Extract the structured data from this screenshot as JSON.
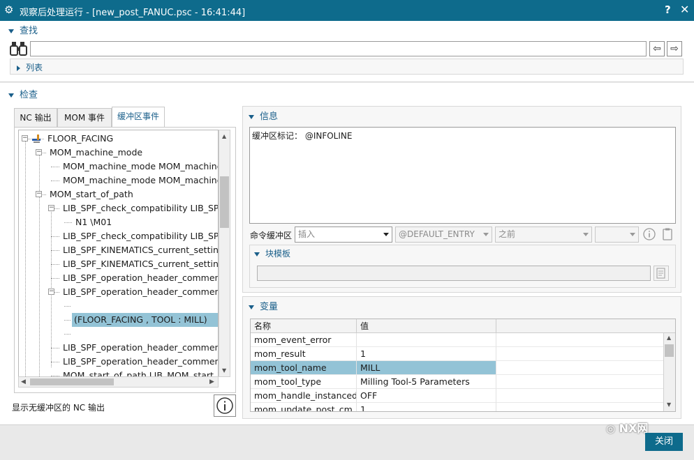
{
  "window": {
    "title": "观察后处理运行 - [new_post_FANUC.psc - 16:41:44]",
    "help_label": "?",
    "close_label": "✕"
  },
  "find": {
    "header": "查找",
    "search_value": "",
    "list_label": "列表"
  },
  "inspect": {
    "header": "检查",
    "tabs": [
      "NC 输出",
      "MOM 事件",
      "缓冲区事件"
    ],
    "active_tab": 2,
    "tree": [
      {
        "label": "FLOOR_FACING",
        "level": 0
      },
      {
        "label": "MOM_machine_mode",
        "level": 1
      },
      {
        "label": "MOM_machine_mode MOM_machine_mode",
        "level": 2
      },
      {
        "label": "MOM_machine_mode MOM_machine_mode",
        "level": 2
      },
      {
        "label": "MOM_start_of_path",
        "level": 1
      },
      {
        "label": "LIB_SPF_check_compatibility LIB_SPF_check_compatibility",
        "level": 2
      },
      {
        "label": "N1 \\M01",
        "level": 3
      },
      {
        "label": "LIB_SPF_check_compatibility LIB_SPF_check_compatibility",
        "level": 2
      },
      {
        "label": "LIB_SPF_KINEMATICS_current_setting LIB_SPF",
        "level": 2
      },
      {
        "label": "LIB_SPF_KINEMATICS_current_setting LIB_SPF",
        "level": 2
      },
      {
        "label": "LIB_SPF_operation_header_comment LIB_SPF",
        "level": 2
      },
      {
        "label": "LIB_SPF_operation_header_comment HEADER",
        "level": 2
      },
      {
        "label": "",
        "level": 3
      },
      {
        "label": "(FLOOR_FACING , TOOL : MILL)",
        "level": 3
      },
      {
        "label": "",
        "level": 3
      },
      {
        "label": "LIB_SPF_operation_header_comment LIB_SPF",
        "level": 2
      },
      {
        "label": "LIB_SPF_operation_header_comment LIB_SPF",
        "level": 2
      },
      {
        "label": "MOM_start_of_path LIB_MOM_start_of_path",
        "level": 2
      }
    ],
    "selected_index": 13,
    "footer_text": "显示无缓冲区的 NC 输出"
  },
  "info": {
    "header": "信息",
    "text": "缓冲区标记：  @INFOLINE",
    "buffer_label": "命令缓冲区",
    "insert_placeholder": "插入",
    "entry_value": "@DEFAULT_ENTRY",
    "position_value": "之前",
    "extra_value": "",
    "block_template_header": "块模板",
    "block_template_value": ""
  },
  "variables": {
    "header": "变量",
    "columns": [
      "名称",
      "值"
    ],
    "rows": [
      {
        "name": "mom_event_error",
        "value": ""
      },
      {
        "name": "mom_result",
        "value": "1"
      },
      {
        "name": "mom_tool_name",
        "value": "MILL"
      },
      {
        "name": "mom_tool_type",
        "value": "Milling Tool-5 Parameters"
      },
      {
        "name": "mom_handle_instanced...",
        "value": "OFF"
      },
      {
        "name": "mom_update_post_cm...",
        "value": "1"
      }
    ],
    "selected_index": 2
  },
  "footer": {
    "close_label": "关闭",
    "watermark": "NX网"
  },
  "colors": {
    "accent": "#0e6b8c",
    "selection": "#93c3d6",
    "section_text": "#1a5f8a"
  }
}
